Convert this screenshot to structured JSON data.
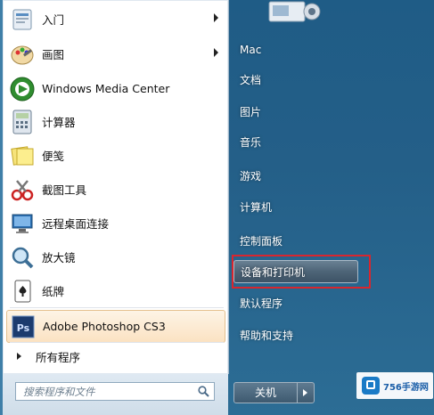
{
  "left_items": [
    {
      "label": "入门",
      "icon": "getting-started-icon",
      "submenu": true
    },
    {
      "label": "画图",
      "icon": "paint-icon",
      "submenu": true
    },
    {
      "label": "Windows Media Center",
      "icon": "media-center-icon",
      "submenu": false
    },
    {
      "label": "计算器",
      "icon": "calculator-icon",
      "submenu": false
    },
    {
      "label": "便笺",
      "icon": "sticky-notes-icon",
      "submenu": false
    },
    {
      "label": "截图工具",
      "icon": "snipping-tool-icon",
      "submenu": false
    },
    {
      "label": "远程桌面连接",
      "icon": "remote-desktop-icon",
      "submenu": false
    },
    {
      "label": "放大镜",
      "icon": "magnifier-icon",
      "submenu": false
    },
    {
      "label": "纸牌",
      "icon": "solitaire-icon",
      "submenu": false
    },
    {
      "label": "Adobe Photoshop CS3",
      "icon": "photoshop-icon",
      "submenu": false
    }
  ],
  "all_programs_label": "所有程序",
  "search": {
    "placeholder": "搜索程序和文件"
  },
  "right_items": [
    {
      "label": "Mac"
    },
    {
      "label": "文档"
    },
    {
      "label": "图片"
    },
    {
      "label": "音乐"
    },
    {
      "label": "游戏"
    },
    {
      "label": "计算机"
    },
    {
      "label": "控制面板"
    },
    {
      "label": "设备和打印机"
    },
    {
      "label": "默认程序"
    },
    {
      "label": "帮助和支持"
    }
  ],
  "shutdown_label": "关机",
  "watermark": {
    "text": "756手游网"
  },
  "colors": {
    "accent": "#d8262e",
    "pane": "#245f88",
    "highlight": "#fbe2c2"
  }
}
